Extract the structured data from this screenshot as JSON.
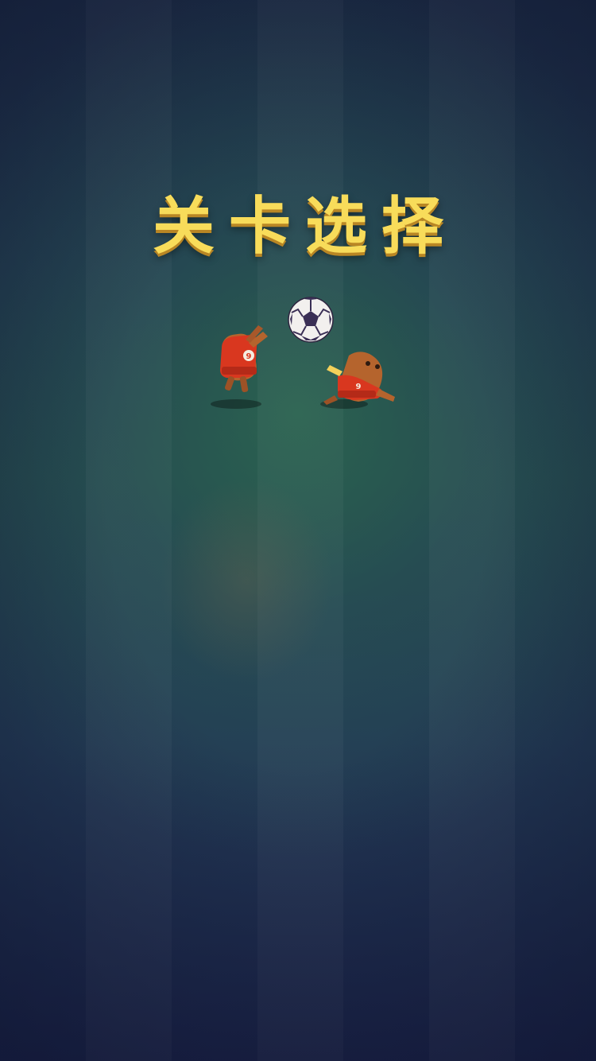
{
  "title": "关卡选择",
  "illustration": {
    "player_number": "9",
    "icons": [
      "soccer-ball-icon",
      "player-left-icon",
      "player-right-icon"
    ]
  },
  "colors": {
    "title": "#f8dc5a",
    "title_shadow": "#b98624",
    "jersey": "#d9371f",
    "skin": "#b5642d",
    "background_top": "#1c2b45",
    "background_mid": "#24444d",
    "background_bottom": "#1b2348"
  }
}
